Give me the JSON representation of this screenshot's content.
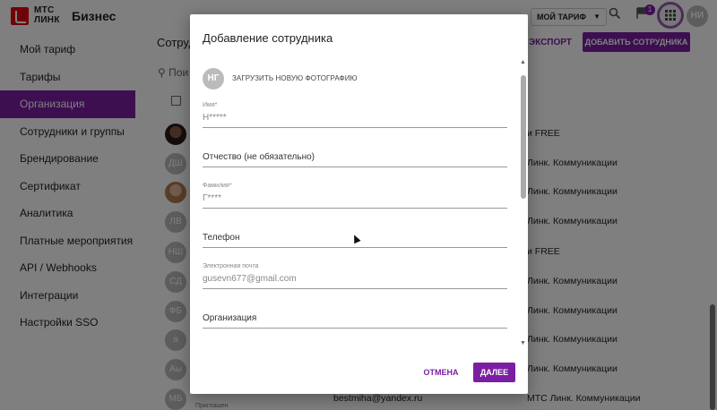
{
  "header": {
    "logo_line1": "МТС",
    "logo_line2": "ЛИНК",
    "product": "Бизнес",
    "tariff_button": "МОЙ ТАРИФ",
    "notification_count": "1",
    "user_initials": "НИ"
  },
  "sidebar": {
    "items": [
      {
        "label": "Мой тариф"
      },
      {
        "label": "Тарифы"
      },
      {
        "label": "Организация"
      },
      {
        "label": "Сотрудники и группы"
      },
      {
        "label": "Брендирование"
      },
      {
        "label": "Сертификат"
      },
      {
        "label": "Аналитика"
      },
      {
        "label": "Платные мероприятия"
      },
      {
        "label": "API / Webhooks"
      },
      {
        "label": "Интеграции"
      },
      {
        "label": "Настройки SSO"
      }
    ],
    "active_index": 2
  },
  "main": {
    "title": "Сотруд",
    "export_label": "ЭКСПОРТ",
    "add_button": "ДОБАВИТЬ СОТРУДНИКА",
    "search_placeholder": "Пои",
    "rows": [
      {
        "initials": "",
        "org": "и FREE"
      },
      {
        "initials": "ДШ",
        "org": "Линк. Коммуникации"
      },
      {
        "initials": "",
        "org": "Линк. Коммуникации"
      },
      {
        "initials": "ЛВ",
        "org": "Линк. Коммуникации"
      },
      {
        "initials": "НШ",
        "org": "и FREE"
      },
      {
        "initials": "СД",
        "org": "Линк. Коммуникации"
      },
      {
        "initials": "ФБ",
        "org": "Линк. Коммуникации"
      },
      {
        "initials": "а",
        "org": "Линк. Коммуникации"
      },
      {
        "initials": "Аы",
        "org": "Линк. Коммуникации"
      },
      {
        "initials": "МБ",
        "org": "МТС Линк. Коммуникации",
        "email": "bestmiha@yandex.ru",
        "status": "Приглашен"
      }
    ]
  },
  "modal": {
    "title": "Добавление сотрудника",
    "photo_initials": "НГ",
    "upload_photo": "ЗАГРУЗИТЬ НОВУЮ ФОТОГРАФИЮ",
    "fields": {
      "first_name_label": "Имя*",
      "first_name_value": "Н*****",
      "patronymic_placeholder": "Отчество (не обязательно)",
      "last_name_label": "Фамилия*",
      "last_name_value": "Г****",
      "phone_placeholder": "Телефон",
      "email_label": "Электронная почта",
      "email_value": "gusevn677@gmail.com",
      "organization_placeholder": "Организация"
    },
    "cancel_button": "ОТМЕНА",
    "next_button": "ДАЛЕЕ"
  },
  "colors": {
    "accent": "#7b1fa2",
    "brand_red": "#e30611"
  }
}
